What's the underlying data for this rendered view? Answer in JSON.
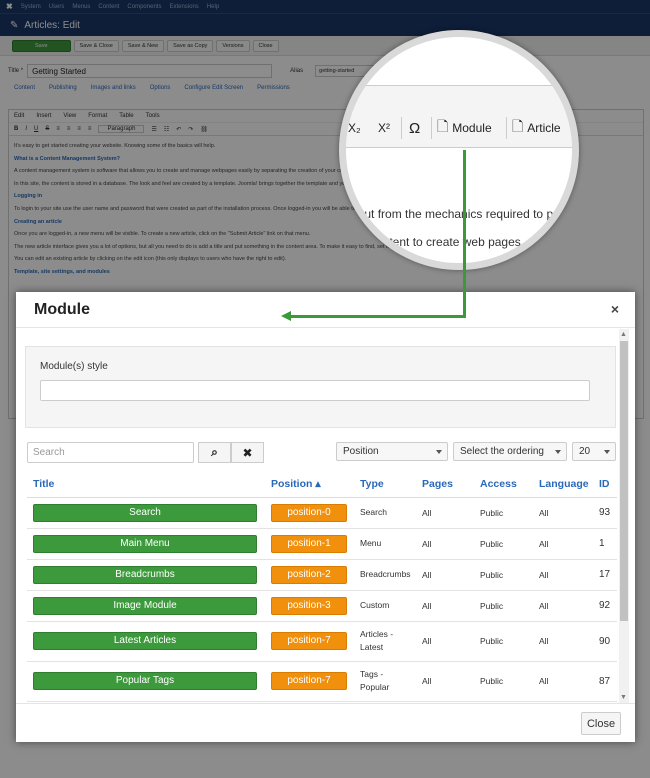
{
  "admin": {
    "menu": [
      "System",
      "Users",
      "Menus",
      "Content",
      "Components",
      "Extensions",
      "Help"
    ],
    "page_title": "Articles: Edit",
    "toolbar": [
      "Save",
      "Save & Close",
      "Save & New",
      "Save as Copy",
      "Versions",
      "Close"
    ],
    "title_label": "Title *",
    "title_value": "Getting Started",
    "alias_label": "Alias",
    "alias_value": "getting-started",
    "tabs": [
      "Content",
      "Publishing",
      "Images and links",
      "Options",
      "Configure Edit Screen",
      "Permissions"
    ],
    "editor_menu": [
      "Edit",
      "Insert",
      "View",
      "Format",
      "Table",
      "Tools"
    ],
    "paragraph_select": "Paragraph",
    "content_lines": [
      {
        "text": "It's easy to get started creating your website. Knowing some of the basics will help.",
        "h": false
      },
      {
        "text": "What is a Content Management System?",
        "h": true
      },
      {
        "text": "A content management system is software that allows you to create and manage webpages easily by separating the creation of your content from the mechanics required to present it",
        "h": false
      },
      {
        "text": "In this site, the content is stored in a database. The look and feel are created by a template. Joomla! brings together the template and your content to create web pages.",
        "h": false
      },
      {
        "text": "Logging in",
        "h": true
      },
      {
        "text": "To login to your site use the user name and password that were created as part of the installation process. Once logged-in you will be able to create and edit articles.",
        "h": false
      },
      {
        "text": "Creating an article",
        "h": true
      },
      {
        "text": "Once you are logged-in, a new menu will be visible. To create a new article, click on the \"Submit Article\" link on that menu.",
        "h": false
      },
      {
        "text": "The new article interface gives you a lot of options, but all you need to do is add a title and put something in the content area. To make it easy to find, set the state to published.",
        "h": false
      },
      {
        "text": "You can edit an existing article by clicking on the edit icon (this only displays to users who have the right to edit).",
        "h": false
      },
      {
        "text": "Template, site settings, and modules",
        "h": true
      }
    ]
  },
  "magnifier": {
    "subscript": "X₂",
    "superscript": "X²",
    "omega": "Ω",
    "module_label": "Module",
    "article_label": "Article",
    "text_line_1": "About from the mechanics required to pre",
    "text_line_2": "ontent to create web pages"
  },
  "modal": {
    "title": "Module",
    "close_x": "×",
    "style_label": "Module(s) style",
    "search_placeholder": "Search",
    "search_icon": "⌕",
    "clear_icon": "✖",
    "filter_position": "Position",
    "filter_ordering": "Select the ordering",
    "filter_limit": "20",
    "columns": {
      "title": "Title",
      "position": "Position ▴",
      "type": "Type",
      "pages": "Pages",
      "access": "Access",
      "language": "Language",
      "id": "ID"
    },
    "rows": [
      {
        "title": "Search",
        "position": "position-0",
        "type": "Search",
        "pages": "All",
        "access": "Public",
        "language": "All",
        "id": "93"
      },
      {
        "title": "Main Menu",
        "position": "position-1",
        "type": "Menu",
        "pages": "All",
        "access": "Public",
        "language": "All",
        "id": "1"
      },
      {
        "title": "Breadcrumbs",
        "position": "position-2",
        "type": "Breadcrumbs",
        "pages": "All",
        "access": "Public",
        "language": "All",
        "id": "17"
      },
      {
        "title": "Image Module",
        "position": "position-3",
        "type": "Custom",
        "pages": "All",
        "access": "Public",
        "language": "All",
        "id": "92"
      },
      {
        "title": "Latest Articles",
        "position": "position-7",
        "type": "Articles - Latest",
        "pages": "All",
        "access": "Public",
        "language": "All",
        "id": "90"
      },
      {
        "title": "Popular Tags",
        "position": "position-7",
        "type": "Tags - Popular",
        "pages": "All",
        "access": "Public",
        "language": "All",
        "id": "87"
      }
    ],
    "close_button": "Close"
  },
  "colors": {
    "green": "#3c9a3c",
    "orange": "#f0900c",
    "link_blue": "#2a69b8",
    "admin_navy": "#1a3867"
  }
}
